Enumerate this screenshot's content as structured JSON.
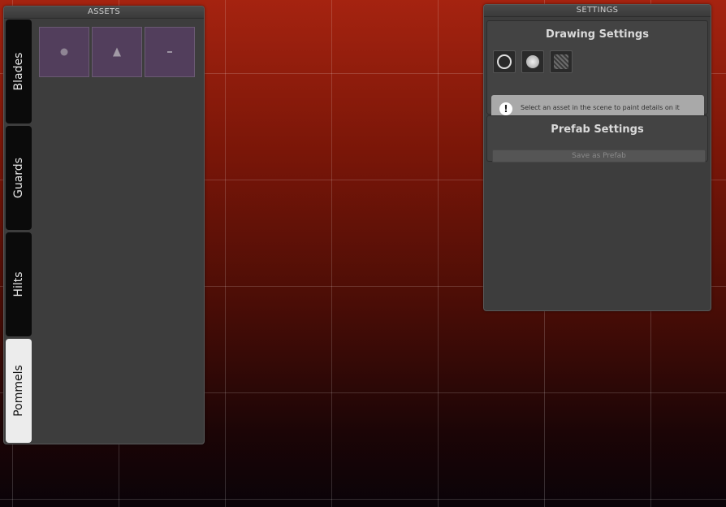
{
  "assets": {
    "title": "ASSETS",
    "tabs": [
      {
        "label": "Blades",
        "active": false
      },
      {
        "label": "Guards",
        "active": false
      },
      {
        "label": "Hilts",
        "active": false
      },
      {
        "label": "Pommels",
        "active": true
      }
    ],
    "thumbnails": [
      {
        "icon": "round-pommel-icon"
      },
      {
        "icon": "cone-pommel-icon"
      },
      {
        "icon": "flat-pommel-icon"
      }
    ]
  },
  "settings": {
    "title": "SETTINGS",
    "drawing": {
      "title": "Drawing Settings",
      "tools": [
        "ring-brush-icon",
        "solid-brush-icon",
        "texture-brush-icon"
      ],
      "message": "Select an asset in the scene to paint details on it",
      "message_icon": "!"
    },
    "prefab": {
      "title": "Prefab Settings",
      "save_label": "Save as Prefab"
    }
  },
  "colors": {
    "panel": "#3d3d3d",
    "thumb": "#523e5c",
    "active_tab": "#ececec"
  }
}
